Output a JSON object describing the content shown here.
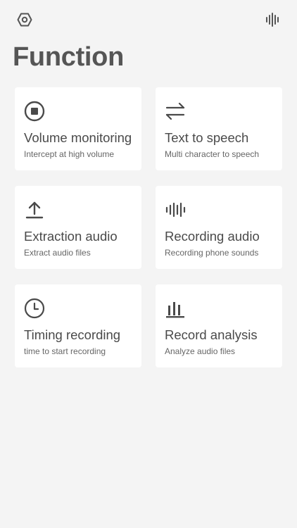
{
  "header": {
    "left_icon": "settings-hexagon-icon",
    "right_icon": "voice-waveform-icon"
  },
  "page": {
    "title": "Function"
  },
  "cards": [
    {
      "icon": "stop-circle-icon",
      "title": "Volume monitoring",
      "subtitle": "Intercept at high volume"
    },
    {
      "icon": "swap-arrows-icon",
      "title": "Text to speech",
      "subtitle": "Multi character to speech"
    },
    {
      "icon": "upload-icon",
      "title": "Extraction audio",
      "subtitle": "Extract audio files"
    },
    {
      "icon": "waveform-icon",
      "title": "Recording audio",
      "subtitle": "Recording phone sounds"
    },
    {
      "icon": "clock-icon",
      "title": "Timing recording",
      "subtitle": "time to start recording"
    },
    {
      "icon": "bar-chart-icon",
      "title": "Record analysis",
      "subtitle": "Analyze audio files"
    }
  ],
  "colors": {
    "background": "#f4f4f4",
    "card": "#ffffff",
    "text": "#4a4a4a",
    "subtext": "#666666"
  }
}
